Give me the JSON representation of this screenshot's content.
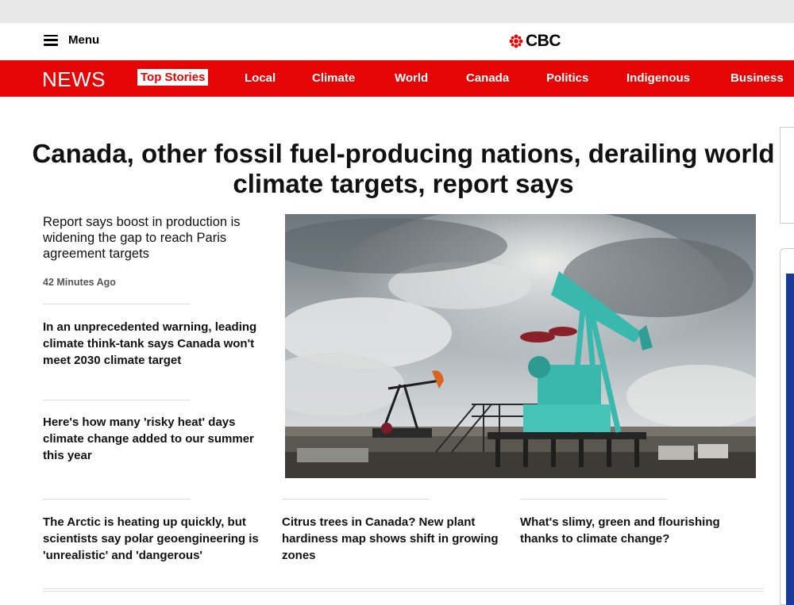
{
  "header": {
    "menu_label": "Menu",
    "logo_text": "CBC",
    "brand_color": "#e60505"
  },
  "nav": {
    "section_title": "NEWS",
    "items": [
      {
        "label": "Top Stories",
        "active": true
      },
      {
        "label": "Local"
      },
      {
        "label": "Climate"
      },
      {
        "label": "World"
      },
      {
        "label": "Canada"
      },
      {
        "label": "Politics"
      },
      {
        "label": "Indigenous"
      },
      {
        "label": "Business"
      }
    ]
  },
  "main": {
    "headline": "Canada, other fossil fuel-producing nations, derailing world climate targets, report says",
    "subheadline": "Report says boost in production is widening the gap to reach Paris agreement targets",
    "timestamp": "42 Minutes Ago",
    "image_icon": "oil-pumpjack-photo"
  },
  "stories": [
    {
      "title": "In an unprecedented warning, leading climate think-tank says Canada won't meet 2030 climate target"
    },
    {
      "title": "Here's how many 'risky heat' days climate change added to our summer this year"
    },
    {
      "title": "The Arctic is heating up quickly, but scientists say polar geoengineering is 'unrealistic' and 'dangerous'"
    },
    {
      "title": "Citrus trees in Canada? New plant hardiness map shows shift in growing zones"
    },
    {
      "title": "What's slimy, green and flourishing thanks to climate change?"
    }
  ]
}
